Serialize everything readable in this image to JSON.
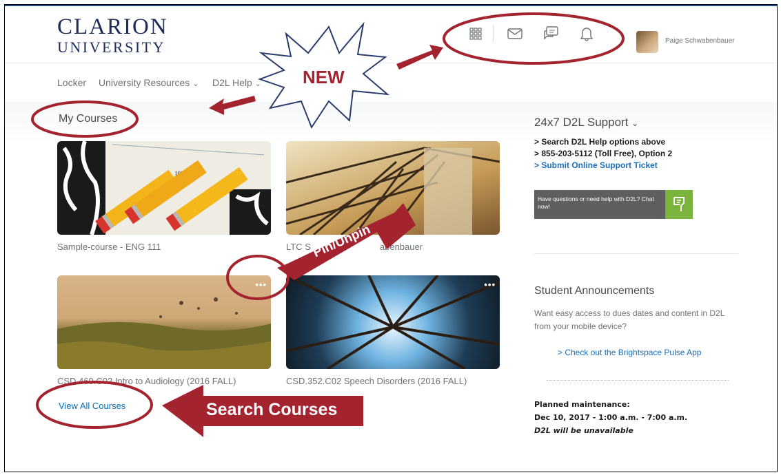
{
  "header": {
    "logo_line1": "CLARION",
    "logo_line2": "UNIVERSITY",
    "user_name": "Paige Schwabenbauer",
    "icons": [
      "apps-grid-icon",
      "mail-icon",
      "chat-icon",
      "bell-icon"
    ]
  },
  "nav": {
    "items": [
      "Locker",
      "University Resources",
      "D2L Help"
    ]
  },
  "courses": {
    "heading": "My Courses",
    "cards": [
      {
        "title": "Sample-course - ENG 111"
      },
      {
        "title": "LTC S",
        "title_tail": "abenbauer"
      },
      {
        "title": "CSD.460.C02 Intro to Audiology (2016 FALL)"
      },
      {
        "title": "CSD.352.C02 Speech Disorders (2016 FALL)"
      }
    ],
    "view_all": "View All Courses",
    "more_glyph": "•••"
  },
  "support": {
    "heading": "24x7 D2L Support",
    "lines": [
      "> Search D2L Help options above",
      "> 855-203-5112 (Toll Free), Option 2",
      "> Submit Online Support Ticket"
    ],
    "chat_text": "Have questions or need help with D2L? Chat now!"
  },
  "announcements": {
    "heading": "Student Announcements",
    "text": "Want easy access to dues dates and content in D2L from your mobile device?",
    "link": "> Check out the Brightspace Pulse App"
  },
  "maintenance": {
    "label": "Planned maintenance:",
    "when": "Dec 10, 2017 - 1:00 a.m. - 7:00 a.m.",
    "note": "D2L will be unavailable"
  },
  "callouts": {
    "new": "NEW",
    "pin": "Pin/Unpin",
    "search": "Search Courses"
  },
  "colors": {
    "annotation_red": "#a3232f",
    "link_blue": "#006fbf",
    "brand_navy": "#1e2d5a",
    "chat_green": "#7ab43c"
  }
}
